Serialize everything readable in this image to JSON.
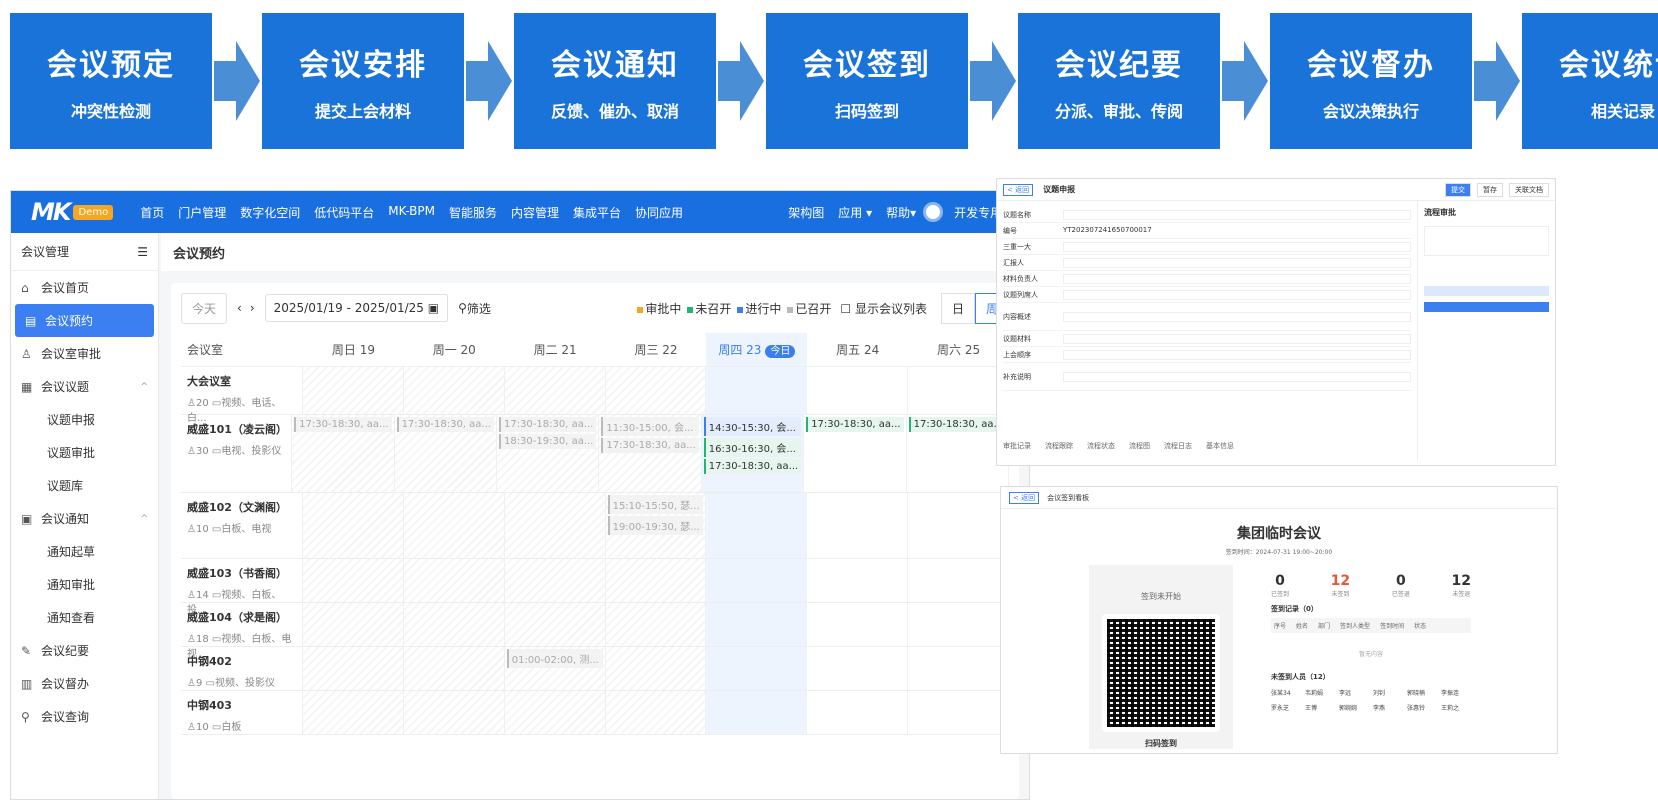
{
  "flow": [
    {
      "title": "会议预定",
      "sub": "冲突性检测"
    },
    {
      "title": "会议安排",
      "sub": "提交上会材料"
    },
    {
      "title": "会议通知",
      "sub": "反馈、催办、取消"
    },
    {
      "title": "会议签到",
      "sub": "扫码签到"
    },
    {
      "title": "会议纪要",
      "sub": "分派、审批、传阅"
    },
    {
      "title": "会议督办",
      "sub": "会议决策执行"
    },
    {
      "title": "会议统计",
      "sub": "相关记录"
    }
  ],
  "nav": {
    "logo": "MK",
    "demo": "Demo",
    "items": [
      "首页",
      "门户管理",
      "数字化空间",
      "低代码平台",
      "MK-BPM",
      "智能服务",
      "内容管理",
      "集成平台",
      "协同应用"
    ],
    "right": [
      "架构图",
      "应用 ▾",
      "帮助▾",
      "开发专用 ▾"
    ]
  },
  "sidebar": {
    "title": "会议管理",
    "items": [
      {
        "label": "会议首页",
        "icon": "⌂"
      },
      {
        "label": "会议预约",
        "icon": "▤",
        "active": true
      },
      {
        "label": "会议室审批",
        "icon": "♙"
      },
      {
        "label": "会议议题",
        "icon": "▦",
        "caret": "^"
      },
      {
        "label": "议题申报",
        "sub": true
      },
      {
        "label": "议题审批",
        "sub": true
      },
      {
        "label": "议题库",
        "sub": true
      },
      {
        "label": "会议通知",
        "icon": "▣",
        "caret": "^"
      },
      {
        "label": "通知起草",
        "sub": true
      },
      {
        "label": "通知审批",
        "sub": true
      },
      {
        "label": "通知查看",
        "sub": true
      },
      {
        "label": "会议纪要",
        "icon": "✎"
      },
      {
        "label": "会议督办",
        "icon": "▥"
      },
      {
        "label": "会议查询",
        "icon": "⚲"
      }
    ]
  },
  "page": {
    "title": "会议预约"
  },
  "toolbar": {
    "today": "今天",
    "range": "2025/01/19 - 2025/01/25",
    "filter": "筛选",
    "legend": [
      {
        "label": "审批中",
        "color": "#f5a623"
      },
      {
        "label": "未召开",
        "color": "#22b573"
      },
      {
        "label": "进行中",
        "color": "#3b7ff0"
      },
      {
        "label": "已召开",
        "color": "#bbbbbb"
      }
    ],
    "showlist": "显示会议列表",
    "day": "日",
    "week": "周"
  },
  "grid": {
    "head": "会议室",
    "days": [
      "周日 19",
      "周一 20",
      "周二 21",
      "周三 22",
      "周四 23",
      "周五 24",
      "周六 25"
    ],
    "today_badge": "今日",
    "rooms": [
      {
        "name": "大会议室",
        "meta": "♙20  ▭视频、电话、白...",
        "h": 48,
        "events": [
          [],
          [],
          [],
          [],
          [],
          [],
          []
        ]
      },
      {
        "name": "威盛101（凌云阁）",
        "meta": "♙30  ▭电视、投影仪",
        "h": 78,
        "events": [
          [
            "17:30-18:30, aa..."
          ],
          [
            "17:30-18:30, aa..."
          ],
          [
            "17:30-18:30, aa...",
            "18:30-19:30, aa..."
          ],
          [
            "11:30-15:00, 会...",
            "17:30-18:30, aa..."
          ],
          [
            "b:14:30-15:30, 会...",
            "g:16:30-16:30, 会...",
            "g:17:30-18:30, aa..."
          ],
          [
            "g:17:30-18:30, aa..."
          ],
          [
            "g:17:30-18:30, aa..."
          ]
        ]
      },
      {
        "name": "威盛102（文渊阁）",
        "meta": "♙10  ▭白板、电视",
        "h": 66,
        "events": [
          [],
          [],
          [],
          [
            "15:10-15:50, 瑟...",
            "19:00-19:30, 瑟..."
          ],
          [],
          [],
          []
        ]
      },
      {
        "name": "威盛103（书香阁）",
        "meta": "♙14  ▭视频、白板、投...",
        "h": 44,
        "events": [
          [],
          [],
          [],
          [],
          [],
          [],
          []
        ]
      },
      {
        "name": "威盛104（求是阁）",
        "meta": "♙18  ▭视频、白板、电视",
        "h": 44,
        "events": [
          [],
          [],
          [],
          [],
          [],
          [],
          []
        ]
      },
      {
        "name": "中钢402",
        "meta": "♙9  ▭视频、投影仪",
        "h": 44,
        "events": [
          [],
          [],
          [
            "01:00-02:00, 测..."
          ],
          [],
          [],
          [],
          []
        ]
      },
      {
        "name": "中钢403",
        "meta": "♙10  ▭白板",
        "h": 44,
        "events": [
          [],
          [],
          [],
          [],
          [],
          [],
          []
        ]
      }
    ]
  },
  "shot1": {
    "title": "议题申报",
    "fields": [
      "议题名称",
      "编号",
      "三重一大",
      "汇报人",
      "材料负责人",
      "议题列席人",
      "内容概述",
      "议题材料",
      "上会顺序",
      "补充说明"
    ],
    "code": "YT202307241650700017",
    "tabs": [
      "审批记录",
      "流程跟踪",
      "流程状态",
      "流程图",
      "流程日志",
      "基本信息"
    ],
    "panel": "流程审批",
    "btns": [
      "提交",
      "暂存",
      "关联文档"
    ]
  },
  "shot2": {
    "back": "< 返回",
    "crumb": "会议签到看板",
    "title": "集团临时会议",
    "time": "签到时间：2024-07-31 19:00~20:00",
    "notstart": "签到未开始",
    "scan": "扫码签到",
    "stats": [
      {
        "v": "0",
        "l": "已签到"
      },
      {
        "v": "12",
        "l": "未签到"
      },
      {
        "v": "0",
        "l": "已签退"
      },
      {
        "v": "12",
        "l": "未签退"
      }
    ],
    "rec": "签到记录（0）",
    "cols": [
      "序号",
      "姓名",
      "部门",
      "签到人类型",
      "签到时间",
      "状态"
    ],
    "empty": "暂无内容",
    "unsigned": "未签到人员（12）",
    "names": [
      "张某34",
      "韦莉娟",
      "李远",
      "刘钊",
      "郭晓楠",
      "李振连",
      "罗永芝",
      "王博",
      "郭婉婉",
      "李燕",
      "张惠铃",
      "王莉之"
    ]
  }
}
